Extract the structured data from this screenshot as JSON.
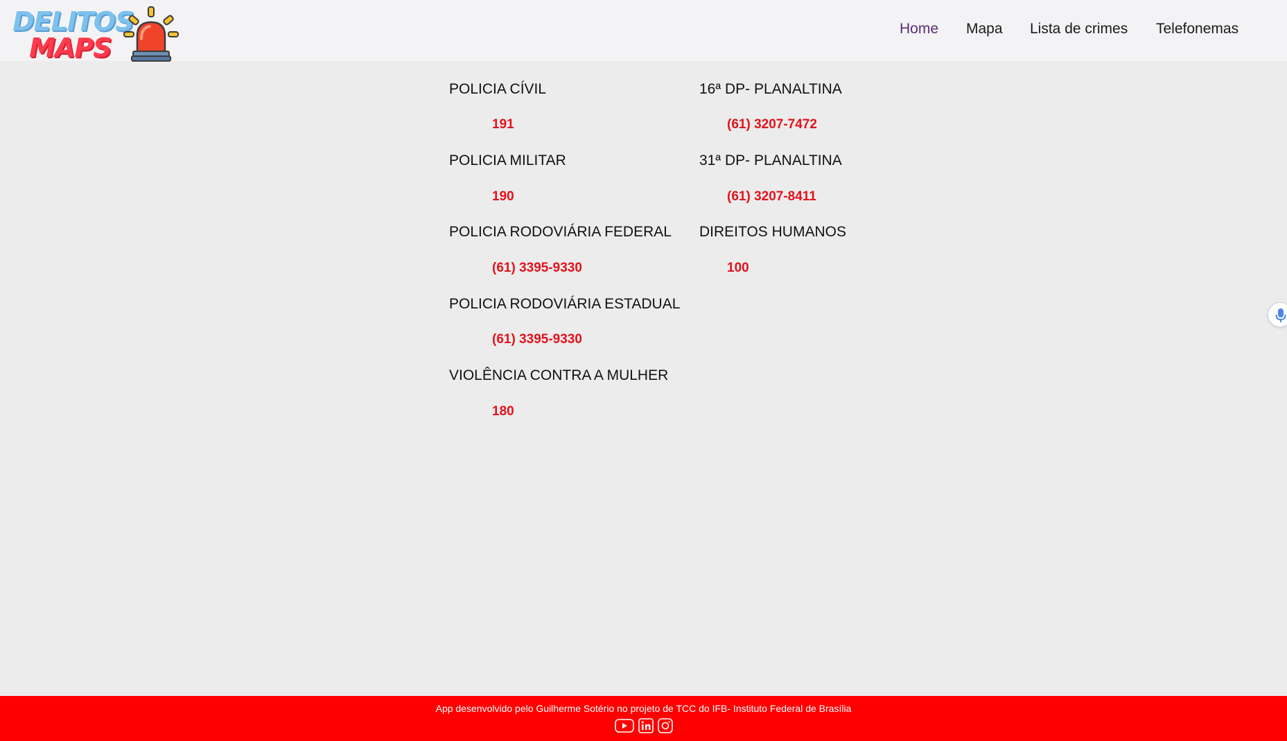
{
  "header": {
    "logo": {
      "line1": "DELITOS",
      "line2": "MAPS",
      "icon": "siren-icon"
    },
    "nav": {
      "home": "Home",
      "mapa": "Mapa",
      "lista": "Lista de crimes",
      "telefonemas": "Telefonemas",
      "active_color": "#5a2d73"
    }
  },
  "contacts": {
    "column1": [
      {
        "title": "POLICIA CÍVIL",
        "number": "191"
      },
      {
        "title": "POLICIA MILITAR",
        "number": "190"
      },
      {
        "title": "POLICIA RODOVIÁRIA FEDERAL",
        "number": "(61) 3395-9330"
      },
      {
        "title": "POLICIA RODOVIÁRIA ESTADUAL",
        "number": "(61) 3395-9330"
      },
      {
        "title": "VIOLÊNCIA CONTRA A MULHER",
        "number": "180"
      }
    ],
    "column2": [
      {
        "title": "16ª DP- PLANALTINA",
        "number": "(61) 3207-7472"
      },
      {
        "title": "31ª DP- PLANALTINA",
        "number": "(61) 3207-8411"
      },
      {
        "title": "DIREITOS HUMANOS",
        "number": "100"
      }
    ],
    "number_color": "#e3121b"
  },
  "mic": {
    "icon": "microphone-icon"
  },
  "footer": {
    "text": "App desenvolvido pelo Guilherme Sotério no projeto de TCC do IFB- Instituto Federal de Brasília",
    "background": "#ff0000",
    "icons": [
      "youtube-icon",
      "linkedin-icon",
      "instagram-icon"
    ]
  }
}
